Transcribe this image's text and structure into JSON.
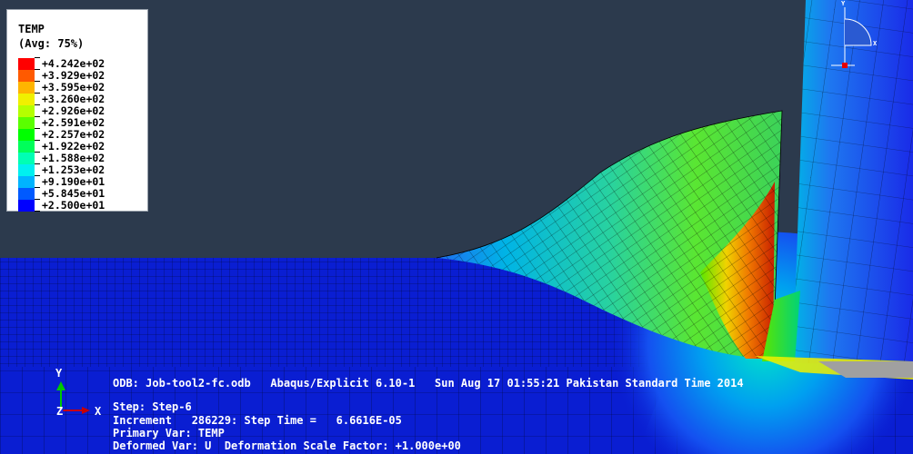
{
  "legend": {
    "title": "TEMP",
    "subtitle": "(Avg: 75%)",
    "entries": [
      {
        "label": "+4.242e+02",
        "color": "#ff0000"
      },
      {
        "label": "+3.929e+02",
        "color": "#ff5a00"
      },
      {
        "label": "+3.595e+02",
        "color": "#ffb400"
      },
      {
        "label": "+3.260e+02",
        "color": "#f0f000"
      },
      {
        "label": "+2.926e+02",
        "color": "#b4ff00"
      },
      {
        "label": "+2.591e+02",
        "color": "#5aff00"
      },
      {
        "label": "+2.257e+02",
        "color": "#00ff00"
      },
      {
        "label": "+1.922e+02",
        "color": "#00ff5a"
      },
      {
        "label": "+1.588e+02",
        "color": "#00ffb4"
      },
      {
        "label": "+1.253e+02",
        "color": "#00f0f0"
      },
      {
        "label": "+9.190e+01",
        "color": "#00b4ff"
      },
      {
        "label": "+5.845e+01",
        "color": "#005aff"
      },
      {
        "label": "+2.500e+01",
        "color": "#0000ff"
      }
    ]
  },
  "info": {
    "odb_line": "ODB: Job-tool2-fc.odb   Abaqus/Explicit 6.10-1   Sun Aug 17 01:55:21 Pakistan Standard Time 2014",
    "step_line": "Step: Step-6",
    "increment_line": "Increment   286229: Step Time =   6.6616E-05",
    "primary_line": "Primary Var: TEMP",
    "deformed_line": "Deformed Var: U  Deformation Scale Factor: +1.000e+00"
  },
  "triad": {
    "y": "Y",
    "x": "X",
    "z": "Z"
  },
  "mini_triad": {
    "y": "Y",
    "x": "X"
  },
  "colors": {
    "background": "#2c3a4d",
    "workpiece_blue": "#0a1ed2",
    "mesh_line": "#000000",
    "tool_blue": "#1a2be8"
  }
}
